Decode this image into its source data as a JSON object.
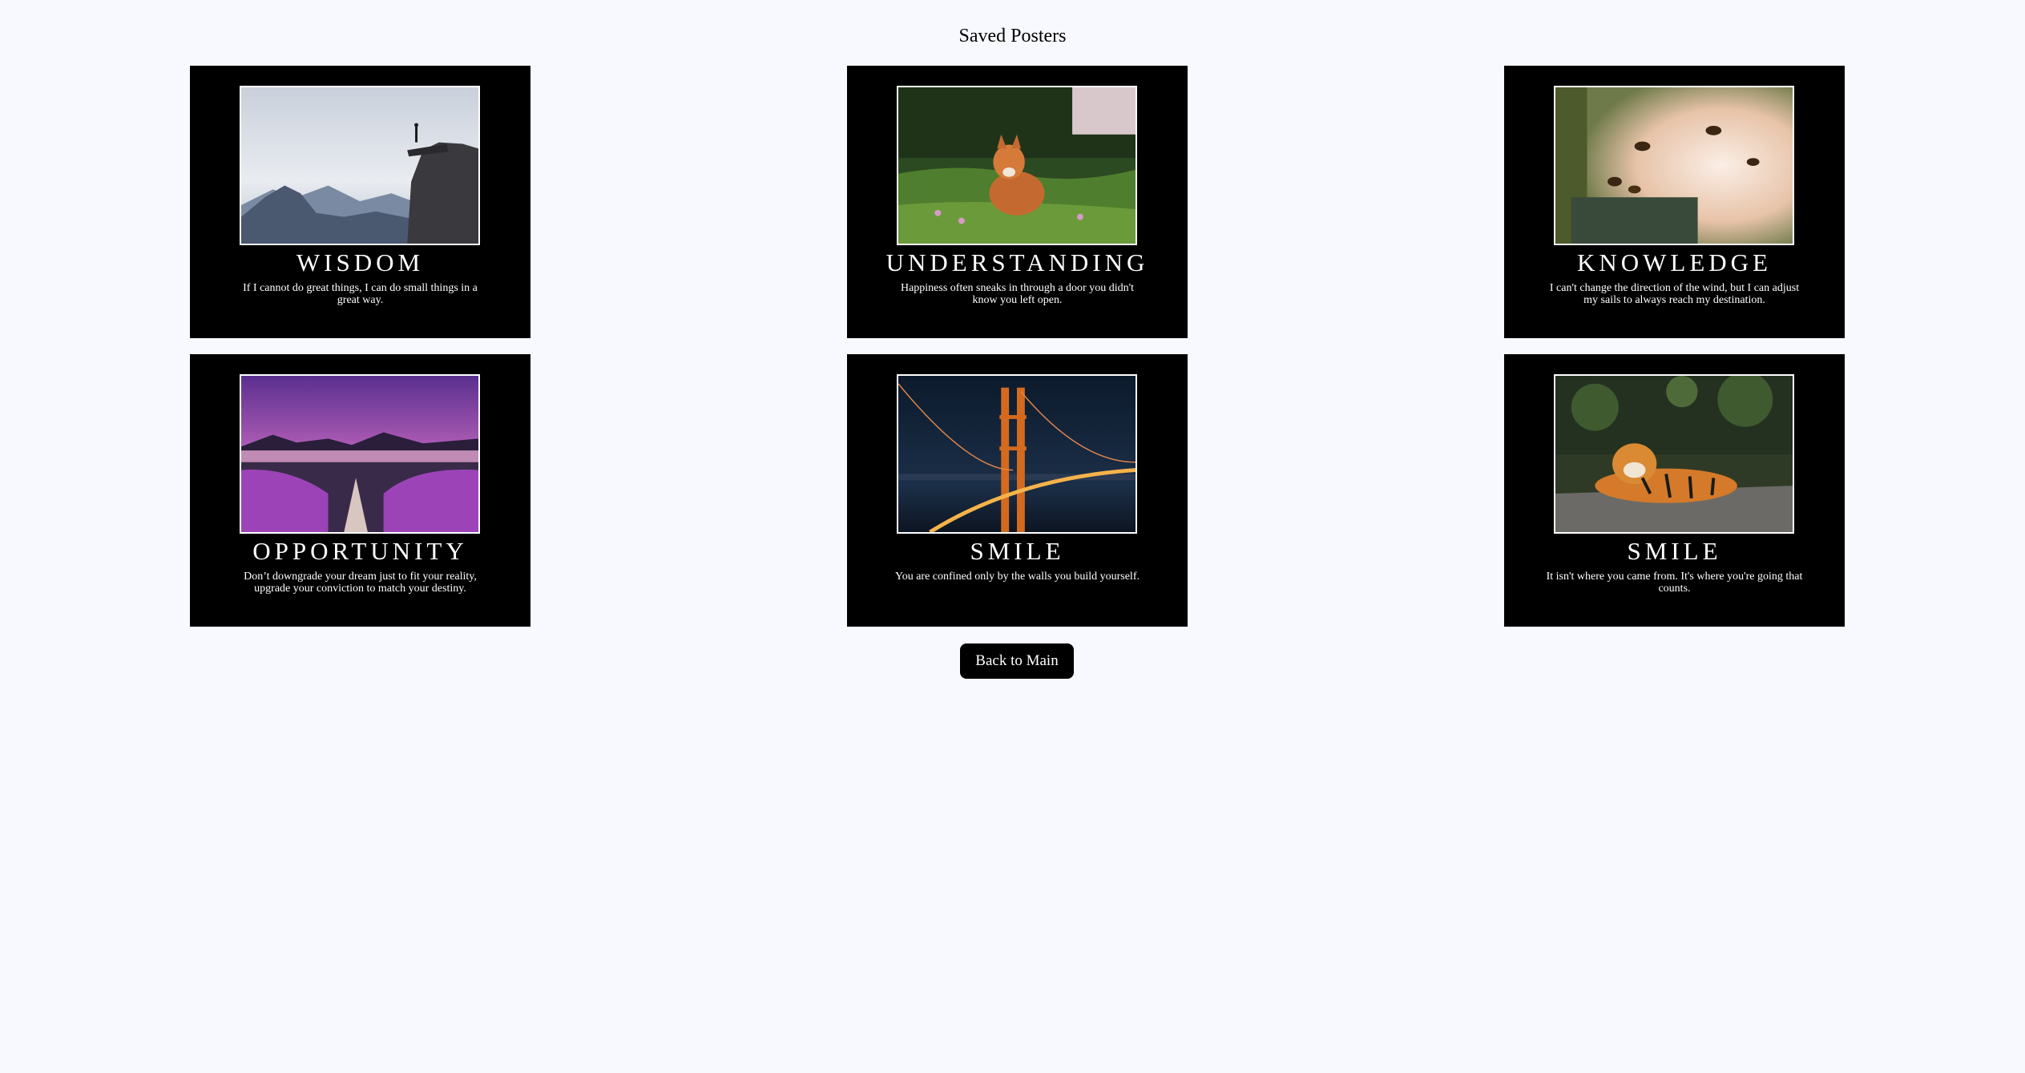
{
  "page": {
    "title": "Saved Posters",
    "background_color": "#f8f8ff"
  },
  "posters": [
    {
      "title": "WISDOM",
      "quote": "If I cannot do great things, I can do small things in a great way.",
      "image": "cliff-hiker-mountains-photo"
    },
    {
      "title": "UNDERSTANDING",
      "quote": "Happiness often sneaks in through a door you didn't know you left open.",
      "image": "fox-in-grass-photo"
    },
    {
      "title": "KNOWLEDGE",
      "quote": "I can't change the direction of the wind, but I can adjust my sails to always reach my destination.",
      "image": "bees-at-hive-photo"
    },
    {
      "title": "OPPORTUNITY",
      "quote": "Don’t downgrade your dream just to fit your reality, upgrade your conviction to match your destiny.",
      "image": "lavender-lake-sunset-photo"
    },
    {
      "title": "SMILE",
      "quote": "You are confined only by the walls you build yourself.",
      "image": "golden-gate-bridge-night-photo"
    },
    {
      "title": "SMILE",
      "quote": "It isn't where you came from. It's where you're going that counts.",
      "image": "tiger-lying-photo"
    }
  ],
  "actions": {
    "back_label": "Back to Main"
  }
}
